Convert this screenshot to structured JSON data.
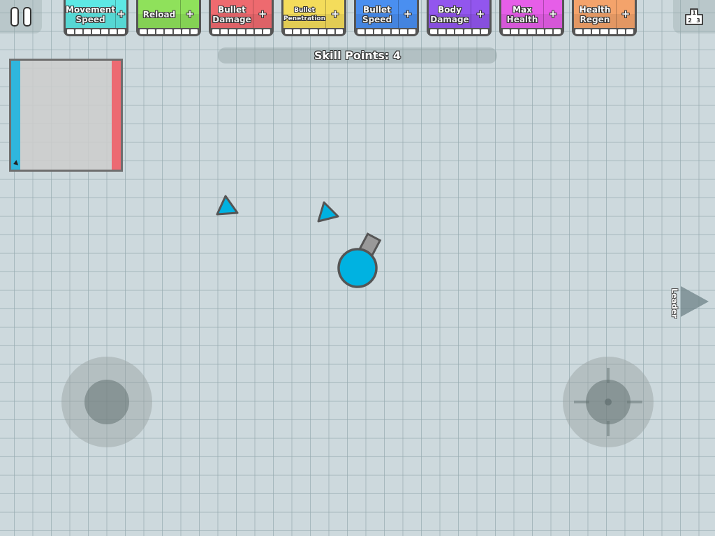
{
  "hud": {
    "pause_icon": "pause-icon",
    "leaderboard_icon": "podium-icon",
    "podium_labels": [
      "1",
      "2",
      "3"
    ],
    "skill_points_label": "Skill Points: 4",
    "leader_label": "Leader"
  },
  "skills": [
    {
      "label": "Movement Speed",
      "plus": "+",
      "color": "#5de8e4",
      "level": 0,
      "max": 7
    },
    {
      "label": "Reload",
      "plus": "+",
      "color": "#8fe15b",
      "level": 0,
      "max": 7
    },
    {
      "label": "Bullet Damage",
      "plus": "+",
      "color": "#ee6a6f",
      "level": 0,
      "max": 7
    },
    {
      "label": "Bullet Penetration",
      "plus": "+",
      "color": "#f4dc5b",
      "level": 0,
      "max": 7
    },
    {
      "label": "Bullet Speed",
      "plus": "+",
      "color": "#4a8ff0",
      "level": 0,
      "max": 7
    },
    {
      "label": "Body Damage",
      "plus": "+",
      "color": "#9256ee",
      "level": 0,
      "max": 7
    },
    {
      "label": "Max Health",
      "plus": "+",
      "color": "#e65ee8",
      "level": 0,
      "max": 7
    },
    {
      "label": "Health Regen",
      "plus": "+",
      "color": "#f4a36b",
      "level": 0,
      "max": 7
    }
  ],
  "minimap": {
    "left_team_color": "#2fb6dd",
    "right_team_color": "#ec6a72"
  },
  "entities": {
    "player_color": "#00b2e1",
    "barrel_color": "#999999",
    "outline_color": "#555555",
    "triangle_color": "#00b2e1"
  }
}
